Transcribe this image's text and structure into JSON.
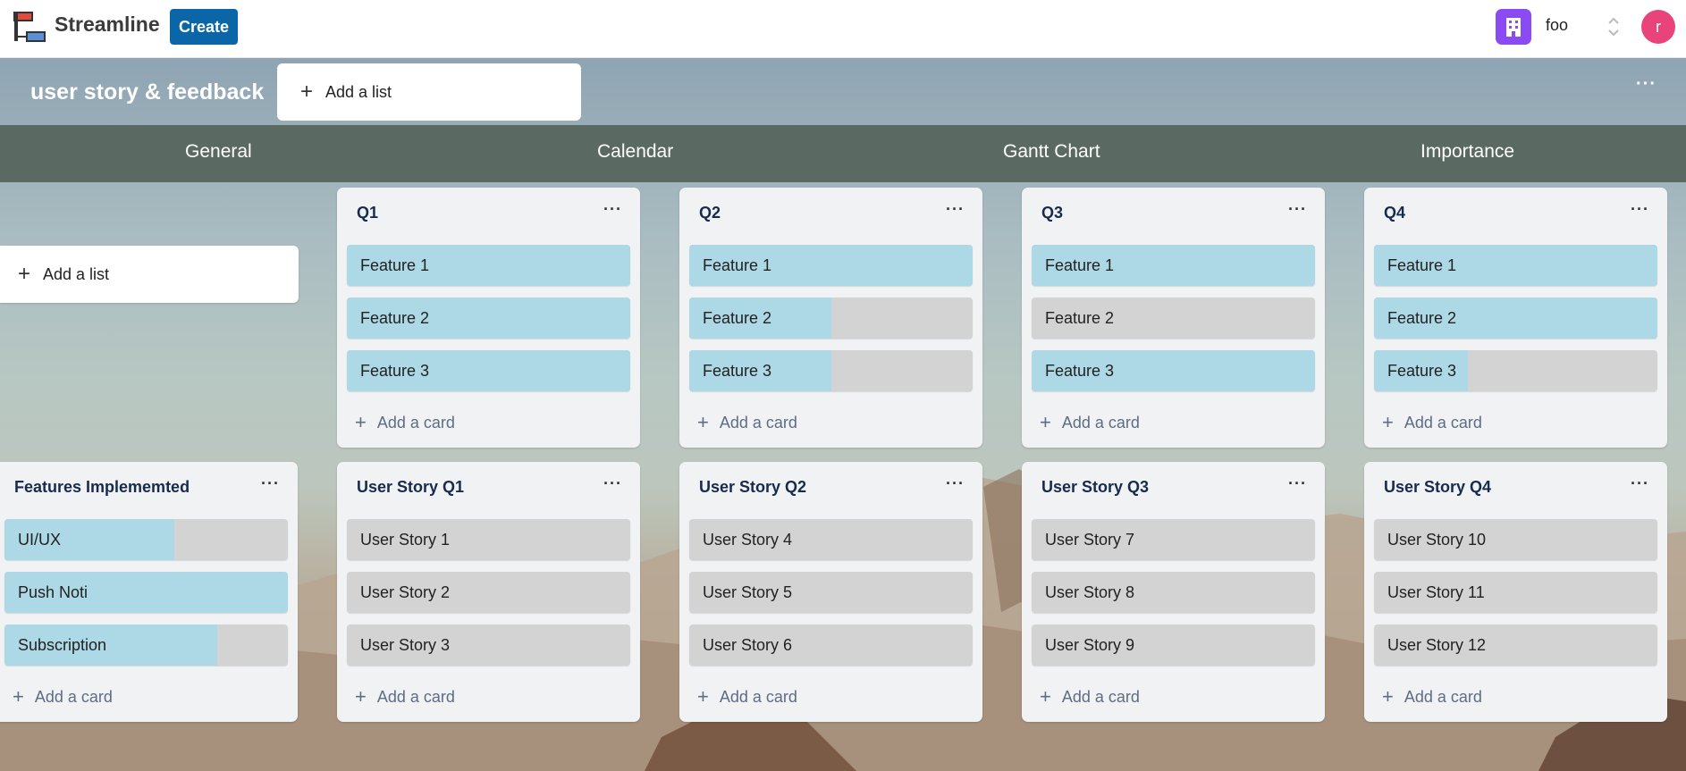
{
  "app": {
    "brand": "Streamline",
    "create_label": "Create",
    "workspace_name": "foo",
    "avatar_letter": "r"
  },
  "board": {
    "title": "user story & feedback",
    "add_list_label": "Add a list",
    "menu_label": "···"
  },
  "views": [
    "General",
    "Calendar",
    "Gantt Chart",
    "Importance"
  ],
  "side_add_list_label": "Add a list",
  "add_card_label": "Add a card",
  "list_menu_label": "···",
  "lists": [
    {
      "title": "Q1",
      "cards": [
        {
          "label": "Feature 1",
          "progress": 1.0
        },
        {
          "label": "Feature 2",
          "progress": 1.0
        },
        {
          "label": "Feature 3",
          "progress": 1.0
        }
      ]
    },
    {
      "title": "Q2",
      "cards": [
        {
          "label": "Feature 1",
          "progress": 1.0
        },
        {
          "label": "Feature 2",
          "progress": 0.5
        },
        {
          "label": "Feature 3",
          "progress": 0.5
        }
      ]
    },
    {
      "title": "Q3",
      "cards": [
        {
          "label": "Feature 1",
          "progress": 1.0
        },
        {
          "label": "Feature 2",
          "progress": 0.0
        },
        {
          "label": "Feature 3",
          "progress": 1.0
        }
      ]
    },
    {
      "title": "Q4",
      "cards": [
        {
          "label": "Feature 1",
          "progress": 1.0
        },
        {
          "label": "Feature 2",
          "progress": 1.0
        },
        {
          "label": "Feature 3",
          "progress": 0.33
        }
      ]
    },
    {
      "title": "Features Implememted",
      "cards": [
        {
          "label": "UI/UX",
          "progress": 0.6
        },
        {
          "label": "Push Noti",
          "progress": 1.0
        },
        {
          "label": "Subscription",
          "progress": 0.75
        }
      ]
    },
    {
      "title": "User Story Q1",
      "cards": [
        {
          "label": "User Story 1",
          "progress": 0.0
        },
        {
          "label": "User Story 2",
          "progress": 0.0
        },
        {
          "label": "User Story 3",
          "progress": 0.0
        }
      ]
    },
    {
      "title": "User Story Q2",
      "cards": [
        {
          "label": "User Story 4",
          "progress": 0.0
        },
        {
          "label": "User Story 5",
          "progress": 0.0
        },
        {
          "label": "User Story 6",
          "progress": 0.0
        }
      ]
    },
    {
      "title": "User Story Q3",
      "cards": [
        {
          "label": "User Story 7",
          "progress": 0.0
        },
        {
          "label": "User Story 8",
          "progress": 0.0
        },
        {
          "label": "User Story 9",
          "progress": 0.0
        }
      ]
    },
    {
      "title": "User Story Q4",
      "cards": [
        {
          "label": "User Story 10",
          "progress": 0.0
        },
        {
          "label": "User Story 11",
          "progress": 0.0
        },
        {
          "label": "User Story 12",
          "progress": 0.0
        }
      ]
    }
  ],
  "colors": {
    "card_done": "#add8e6",
    "card_base": "#d3d3d3",
    "create_button": "#0b66a8",
    "workspace_icon": "#8b4bf2",
    "avatar": "#e8437b",
    "view_bar": "#5a6a62"
  }
}
